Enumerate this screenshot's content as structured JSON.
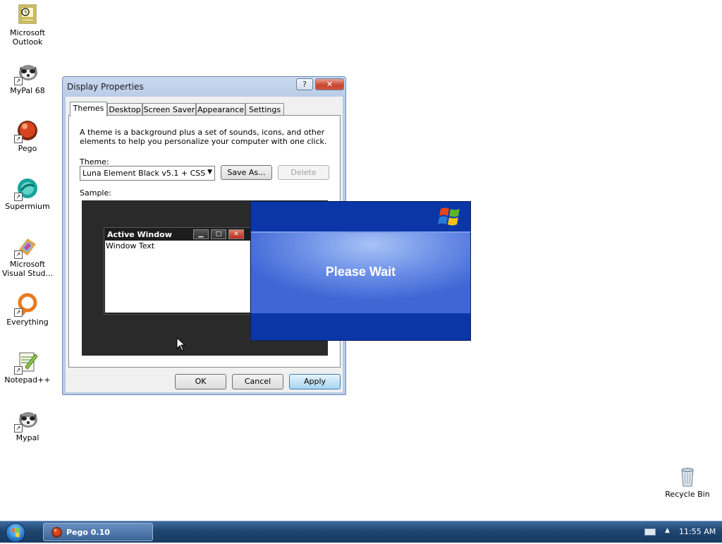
{
  "desktop": {
    "icons": [
      {
        "label": "Microsoft Outlook",
        "icon": "outlook-icon"
      },
      {
        "label": "MyPal 68",
        "icon": "mypal-icon"
      },
      {
        "label": "Pego",
        "icon": "pego-icon"
      },
      {
        "label": "Supermium",
        "icon": "supermium-icon"
      },
      {
        "label": "Microsoft Visual Stud...",
        "icon": "visual-studio-icon"
      },
      {
        "label": "Everything",
        "icon": "everything-icon"
      },
      {
        "label": "Notepad++",
        "icon": "notepadpp-icon"
      },
      {
        "label": "Mypal",
        "icon": "mypal-icon"
      },
      {
        "label": "Recycle Bin",
        "icon": "recycle-bin-icon"
      }
    ]
  },
  "dialog": {
    "title": "Display Properties",
    "help_label": "?",
    "close_label": "✕",
    "tabs": [
      "Themes",
      "Desktop",
      "Screen Saver",
      "Appearance",
      "Settings"
    ],
    "active_tab": "Themes",
    "description": "A theme is a background plus a set of sounds, icons, and other elements to help you personalize your computer with one click.",
    "theme_label": "Theme:",
    "theme_value": "Luna Element Black v5.1 + CSS",
    "save_as_label": "Save As...",
    "delete_label": "Delete",
    "sample_label": "Sample:",
    "sample": {
      "window_title": "Active Window",
      "window_text": "Window Text"
    },
    "ok_label": "OK",
    "cancel_label": "Cancel",
    "apply_label": "Apply"
  },
  "splash": {
    "message": "Please Wait"
  },
  "taskbar": {
    "task_label": "Pego 0.10",
    "clock": "11:55 AM"
  }
}
